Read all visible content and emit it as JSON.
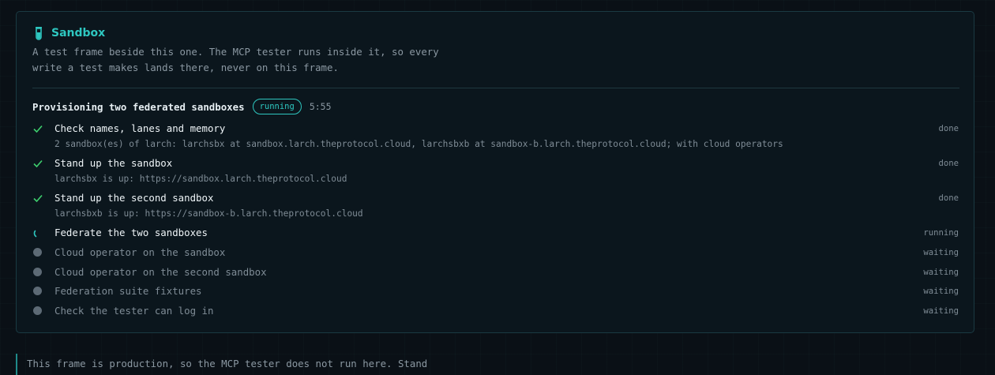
{
  "sandbox": {
    "icon": "test-tube-icon",
    "title": "Sandbox",
    "description_line1": "A test frame beside this one. The MCP tester runs inside it, so every",
    "description_line2": "write a test makes lands there, never on this frame."
  },
  "provisioning": {
    "title": "Provisioning two federated sandboxes",
    "badge": "running",
    "elapsed": "5:55"
  },
  "steps": [
    {
      "label": "Check names, lanes and memory",
      "status": "done",
      "icon": "check-icon",
      "detail": "2 sandbox(es) of larch: larchsbx at sandbox.larch.theprotocol.cloud, larchsbxb at sandbox-b.larch.theprotocol.cloud; with cloud operators"
    },
    {
      "label": "Stand up the sandbox",
      "status": "done",
      "icon": "check-icon",
      "detail": "larchsbx is up: https://sandbox.larch.theprotocol.cloud"
    },
    {
      "label": "Stand up the second sandbox",
      "status": "done",
      "icon": "check-icon",
      "detail": "larchsbxb is up: https://sandbox-b.larch.theprotocol.cloud"
    },
    {
      "label": "Federate the two sandboxes",
      "status": "running",
      "icon": "spinner-icon"
    },
    {
      "label": "Cloud operator on the sandbox",
      "status": "waiting",
      "icon": "pending-dot-icon"
    },
    {
      "label": "Cloud operator on the second sandbox",
      "status": "waiting",
      "icon": "pending-dot-icon"
    },
    {
      "label": "Federation suite fixtures",
      "status": "waiting",
      "icon": "pending-dot-icon"
    },
    {
      "label": "Check the tester can log in",
      "status": "waiting",
      "icon": "pending-dot-icon"
    }
  ],
  "note": {
    "text": "This frame is production, so the MCP tester does not run here. Stand"
  },
  "colors": {
    "accent": "#2ec7c0",
    "done": "#3ecf6e",
    "pending": "#5d6a75"
  }
}
